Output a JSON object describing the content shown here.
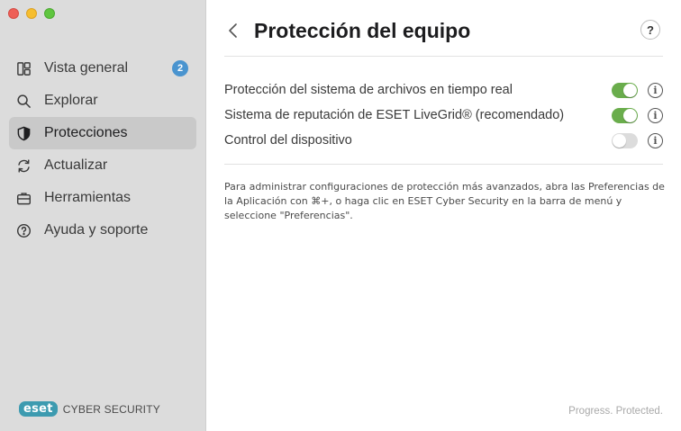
{
  "window": {
    "controls": [
      "close",
      "minimize",
      "maximize"
    ]
  },
  "sidebar": {
    "items": [
      {
        "label": "Vista general",
        "icon": "overview-icon",
        "badge": "2",
        "active": false
      },
      {
        "label": "Explorar",
        "icon": "search-icon",
        "active": false
      },
      {
        "label": "Protecciones",
        "icon": "shield-icon",
        "active": true
      },
      {
        "label": "Actualizar",
        "icon": "refresh-icon",
        "active": false
      },
      {
        "label": "Herramientas",
        "icon": "briefcase-icon",
        "active": false
      },
      {
        "label": "Ayuda y soporte",
        "icon": "help-circle-icon",
        "active": false
      }
    ],
    "brand": {
      "logo": "eset",
      "product": "CYBER SECURITY"
    }
  },
  "main": {
    "title": "Protección del equipo",
    "help_label": "?",
    "settings": [
      {
        "label": "Protección del sistema de archivos en tiempo real",
        "enabled": true
      },
      {
        "label": "Sistema de reputación de ESET LiveGrid® (recomendado)",
        "enabled": true
      },
      {
        "label": "Control del dispositivo",
        "enabled": false
      }
    ],
    "note": "Para administrar configuraciones de protección más avanzados, abra las Preferencias de la Aplicación con ⌘+, o haga clic en ESET Cyber Security en la barra de menú y seleccione \"Preferencias\".",
    "footer": "Progress. Protected."
  },
  "colors": {
    "sidebar_bg": "#dcdcdc",
    "active_item_bg": "#c9c9c9",
    "toggle_on": "#6aad4c",
    "toggle_off": "#dcdcdc",
    "badge": "#4a94cf",
    "brand": "#3d9bb0"
  }
}
